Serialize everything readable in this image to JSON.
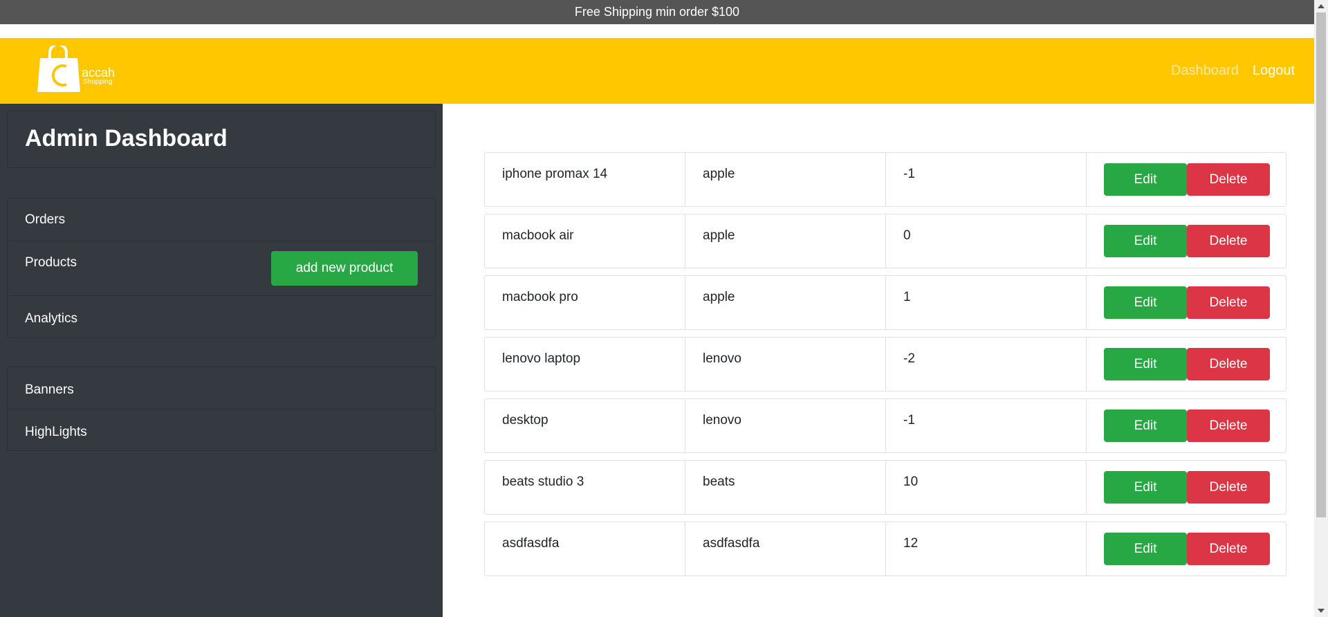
{
  "topbar": {
    "text": "Free Shipping min order $100"
  },
  "brand": {
    "name": "accah",
    "tagline": "Shopping",
    "logo_icon": "shopping-bag-icon"
  },
  "nav": {
    "dashboard": "Dashboard",
    "logout": "Logout"
  },
  "sidebar": {
    "title": "Admin Dashboard",
    "group1": [
      "Orders",
      "Products",
      "Analytics"
    ],
    "group2": [
      "Banners",
      "HighLights"
    ],
    "add_button": "add new product"
  },
  "products": [
    {
      "name": "iphone promax 14",
      "brand": "apple",
      "stock": "-1"
    },
    {
      "name": "macbook air",
      "brand": "apple",
      "stock": "0"
    },
    {
      "name": "macbook pro",
      "brand": "apple",
      "stock": "1"
    },
    {
      "name": "lenovo laptop",
      "brand": "lenovo",
      "stock": "-2"
    },
    {
      "name": "desktop",
      "brand": "lenovo",
      "stock": "-1"
    },
    {
      "name": "beats studio 3",
      "brand": "beats",
      "stock": "10"
    },
    {
      "name": "asdfasdfa",
      "brand": "asdfasdfa",
      "stock": "12"
    }
  ],
  "actions": {
    "edit": "Edit",
    "delete": "Delete"
  },
  "colors": {
    "navbar": "#ffc700",
    "sidebar": "#343a40",
    "success": "#28a745",
    "danger": "#dc3545"
  }
}
